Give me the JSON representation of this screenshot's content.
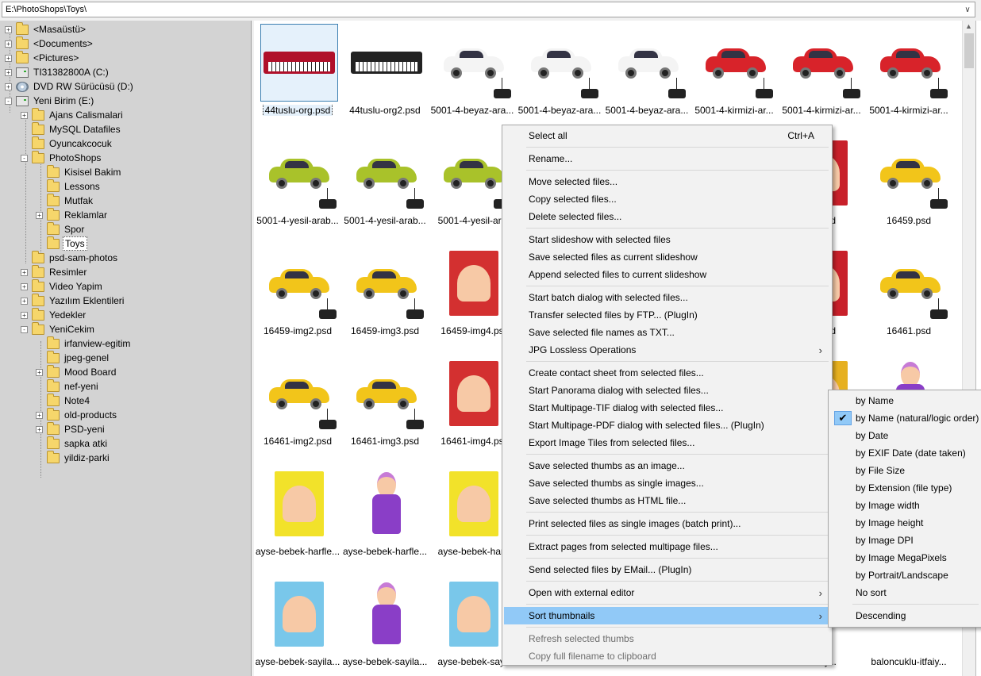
{
  "address": {
    "path": "E:\\PhotoShops\\Toys\\"
  },
  "tree": [
    {
      "label": "<Masaüstü>",
      "type": "folder",
      "exp": "+",
      "level": 0
    },
    {
      "label": "<Documents>",
      "type": "folder",
      "exp": "+",
      "level": 0
    },
    {
      "label": "<Pictures>",
      "type": "folder",
      "exp": "+",
      "level": 0
    },
    {
      "label": "TI31382800A (C:)",
      "type": "drive",
      "exp": "+",
      "level": 0
    },
    {
      "label": "DVD RW Sürücüsü (D:)",
      "type": "dvd",
      "exp": "+",
      "level": 0
    },
    {
      "label": "Yeni Birim (E:)",
      "type": "drive",
      "exp": "-",
      "level": 0
    },
    {
      "label": "Ajans Calismalari",
      "type": "folder",
      "exp": "+",
      "level": 1
    },
    {
      "label": "MySQL Datafiles",
      "type": "folder",
      "exp": "",
      "level": 1
    },
    {
      "label": "Oyuncakcocuk",
      "type": "folder",
      "exp": "",
      "level": 1
    },
    {
      "label": "PhotoShops",
      "type": "folder",
      "exp": "-",
      "level": 1
    },
    {
      "label": "Kisisel Bakim",
      "type": "folder",
      "exp": "",
      "level": 2
    },
    {
      "label": "Lessons",
      "type": "folder",
      "exp": "",
      "level": 2
    },
    {
      "label": "Mutfak",
      "type": "folder",
      "exp": "",
      "level": 2
    },
    {
      "label": "Reklamlar",
      "type": "folder",
      "exp": "+",
      "level": 2
    },
    {
      "label": "Spor",
      "type": "folder",
      "exp": "",
      "level": 2
    },
    {
      "label": "Toys",
      "type": "folder",
      "exp": "",
      "level": 2,
      "selected": true
    },
    {
      "label": "psd-sam-photos",
      "type": "folder",
      "exp": "",
      "level": 1
    },
    {
      "label": "Resimler",
      "type": "folder",
      "exp": "+",
      "level": 1
    },
    {
      "label": "Video Yapim",
      "type": "folder",
      "exp": "+",
      "level": 1
    },
    {
      "label": "Yazılım Eklentileri",
      "type": "folder",
      "exp": "+",
      "level": 1
    },
    {
      "label": "Yedekler",
      "type": "folder",
      "exp": "+",
      "level": 1
    },
    {
      "label": "YeniCekim",
      "type": "folder",
      "exp": "-",
      "level": 1
    },
    {
      "label": "irfanview-egitim",
      "type": "folder",
      "exp": "",
      "level": 2
    },
    {
      "label": "jpeg-genel",
      "type": "folder",
      "exp": "",
      "level": 2
    },
    {
      "label": "Mood Board",
      "type": "folder",
      "exp": "+",
      "level": 2
    },
    {
      "label": "nef-yeni",
      "type": "folder",
      "exp": "",
      "level": 2
    },
    {
      "label": "Note4",
      "type": "folder",
      "exp": "",
      "level": 2
    },
    {
      "label": "old-products",
      "type": "folder",
      "exp": "+",
      "level": 2
    },
    {
      "label": "PSD-yeni",
      "type": "folder",
      "exp": "+",
      "level": 2
    },
    {
      "label": "sapka atki",
      "type": "folder",
      "exp": "",
      "level": 2
    },
    {
      "label": "yildiz-parki",
      "type": "folder",
      "exp": "",
      "level": 2
    }
  ],
  "thumbs": [
    {
      "row": 0,
      "col": 0,
      "name": "44tuslu-org.psd",
      "kind": "keyboard-red",
      "selected": true
    },
    {
      "row": 0,
      "col": 1,
      "name": "44tuslu-org2.psd",
      "kind": "keyboard"
    },
    {
      "row": 0,
      "col": 2,
      "name": "5001-4-beyaz-ara...",
      "kind": "car",
      "color": "#f4f4f4"
    },
    {
      "row": 0,
      "col": 3,
      "name": "5001-4-beyaz-ara...",
      "kind": "car",
      "color": "#f4f4f4"
    },
    {
      "row": 0,
      "col": 4,
      "name": "5001-4-beyaz-ara...",
      "kind": "car",
      "color": "#f4f4f4"
    },
    {
      "row": 0,
      "col": 5,
      "name": "5001-4-kirmizi-ar...",
      "kind": "car",
      "color": "#d8232a"
    },
    {
      "row": 0,
      "col": 6,
      "name": "5001-4-kirmizi-ar...",
      "kind": "car",
      "color": "#d8232a"
    },
    {
      "row": 0,
      "col": 7,
      "name": "5001-4-kirmizi-ar...",
      "kind": "car",
      "color": "#d8232a"
    },
    {
      "row": 1,
      "col": 0,
      "name": "5001-4-yesil-arab...",
      "kind": "car",
      "color": "#a9c22a"
    },
    {
      "row": 1,
      "col": 1,
      "name": "5001-4-yesil-arab...",
      "kind": "car",
      "color": "#a9c22a"
    },
    {
      "row": 1,
      "col": 2,
      "name": "5001-4-yesil-ara",
      "kind": "car",
      "color": "#a9c22a"
    },
    {
      "row": 1,
      "col": 6,
      "name": "g4.psd",
      "kind": "box",
      "color": "#c8202a"
    },
    {
      "row": 1,
      "col": 7,
      "name": "16459.psd",
      "kind": "car",
      "color": "#f2c51a"
    },
    {
      "row": 2,
      "col": 0,
      "name": "16459-img2.psd",
      "kind": "car",
      "color": "#f2c51a"
    },
    {
      "row": 2,
      "col": 1,
      "name": "16459-img3.psd",
      "kind": "car",
      "color": "#f2c51a"
    },
    {
      "row": 2,
      "col": 2,
      "name": "16459-img4.ps",
      "kind": "box",
      "color": "#d33030"
    },
    {
      "row": 2,
      "col": 6,
      "name": "g4.psd",
      "kind": "box",
      "color": "#c8202a"
    },
    {
      "row": 2,
      "col": 7,
      "name": "16461.psd",
      "kind": "car",
      "color": "#f2c51a"
    },
    {
      "row": 3,
      "col": 0,
      "name": "16461-img2.psd",
      "kind": "car",
      "color": "#f2c51a"
    },
    {
      "row": 3,
      "col": 1,
      "name": "16461-img3.psd",
      "kind": "car",
      "color": "#f2c51a"
    },
    {
      "row": 3,
      "col": 2,
      "name": "16461-img4.ps",
      "kind": "box",
      "color": "#d33030"
    },
    {
      "row": 3,
      "col": 6,
      "name": "",
      "kind": "box",
      "color": "#e6b020"
    },
    {
      "row": 3,
      "col": 7,
      "name": "",
      "kind": "doll",
      "color": "#8a3ec7"
    },
    {
      "row": 4,
      "col": 0,
      "name": "ayse-bebek-harfle...",
      "kind": "box",
      "color": "#f2e22a"
    },
    {
      "row": 4,
      "col": 1,
      "name": "ayse-bebek-harfle...",
      "kind": "doll",
      "color": "#8a3ec7"
    },
    {
      "row": 4,
      "col": 2,
      "name": "ayse-bebek-harf",
      "kind": "box",
      "color": "#f2e22a"
    },
    {
      "row": 5,
      "col": 0,
      "name": "ayse-bebek-sayila...",
      "kind": "box",
      "color": "#79c7ea"
    },
    {
      "row": 5,
      "col": 1,
      "name": "ayse-bebek-sayila...",
      "kind": "doll",
      "color": "#f2a6b8"
    },
    {
      "row": 5,
      "col": 2,
      "name": "ayse-bebek-sayi",
      "kind": "box",
      "color": "#79c7ea"
    },
    {
      "row": 5,
      "col": 6,
      "name": "-itfaiy...",
      "kind": "none"
    },
    {
      "row": 5,
      "col": 7,
      "name": "baloncuklu-itfaiy...",
      "kind": "none"
    }
  ],
  "context_menu": {
    "items": [
      {
        "label": "Select all",
        "shortcut": "Ctrl+A",
        "y": 0
      },
      {
        "sep": true
      },
      {
        "label": "Rename..."
      },
      {
        "sep": true
      },
      {
        "label": "Move selected files..."
      },
      {
        "label": "Copy selected files..."
      },
      {
        "label": "Delete selected files..."
      },
      {
        "sep": true
      },
      {
        "label": "Start slideshow with selected files"
      },
      {
        "label": "Save selected files as current slideshow"
      },
      {
        "label": "Append selected files to current slideshow"
      },
      {
        "sep": true
      },
      {
        "label": "Start batch dialog with selected files..."
      },
      {
        "label": "Transfer selected files by FTP... (PlugIn)"
      },
      {
        "label": "Save selected file names as TXT..."
      },
      {
        "label": "JPG Lossless Operations",
        "submenu": true
      },
      {
        "sep": true
      },
      {
        "label": "Create contact sheet from selected files..."
      },
      {
        "label": "Start Panorama dialog with selected files..."
      },
      {
        "label": "Start Multipage-TIF dialog with selected files..."
      },
      {
        "label": "Start Multipage-PDF dialog with selected files... (PlugIn)"
      },
      {
        "label": "Export Image Tiles from selected files..."
      },
      {
        "sep": true
      },
      {
        "label": "Save selected thumbs as an image..."
      },
      {
        "label": "Save selected thumbs as single images..."
      },
      {
        "label": "Save selected thumbs as HTML file..."
      },
      {
        "sep": true
      },
      {
        "label": "Print selected files as single images (batch print)..."
      },
      {
        "sep": true
      },
      {
        "label": "Extract pages from selected multipage files..."
      },
      {
        "sep": true
      },
      {
        "label": "Send selected files by EMail... (PlugIn)"
      },
      {
        "sep": true
      },
      {
        "label": "Open with external editor",
        "submenu": true
      },
      {
        "sep": true
      },
      {
        "label": "Sort thumbnails",
        "submenu": true,
        "highlighted": true
      },
      {
        "sep": true
      },
      {
        "label": "Refresh selected thumbs",
        "disabled": true
      },
      {
        "label": "Copy full filename to clipboard",
        "disabled": true
      }
    ]
  },
  "sort_submenu": {
    "items": [
      {
        "label": "by Name"
      },
      {
        "label": "by Name (natural/logic order)",
        "checked": true
      },
      {
        "label": "by Date"
      },
      {
        "label": "by EXIF Date (date taken)"
      },
      {
        "label": "by File Size"
      },
      {
        "label": "by Extension (file type)"
      },
      {
        "label": "by Image width"
      },
      {
        "label": "by Image height"
      },
      {
        "label": "by Image DPI"
      },
      {
        "label": "by Image MegaPixels"
      },
      {
        "label": "by Portrait/Landscape"
      },
      {
        "label": "No sort"
      },
      {
        "sep": true
      },
      {
        "label": "Descending"
      }
    ]
  },
  "icons": {
    "checkmark": "checkmark-icon",
    "submenu_arrow": "chevron-right-icon",
    "dropdown": "chevron-down-icon"
  }
}
